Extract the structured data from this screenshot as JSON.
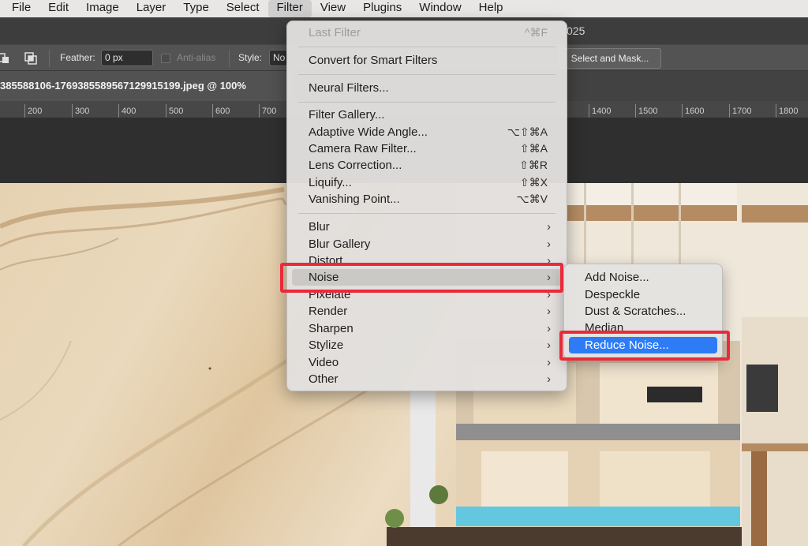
{
  "menubar": {
    "items": [
      "File",
      "Edit",
      "Image",
      "Layer",
      "Type",
      "Select",
      "Filter",
      "View",
      "Plugins",
      "Window",
      "Help"
    ],
    "active": "Filter"
  },
  "window": {
    "title_fragment": "025"
  },
  "options_bar": {
    "feather_label": "Feather:",
    "feather_value": "0 px",
    "antialias_label": "Anti-alias",
    "style_label": "Style:",
    "style_value": "No",
    "select_mask_button": "Select and Mask..."
  },
  "document_tab": {
    "title": "385588106-1769385589567129915199.jpeg @ 100%"
  },
  "ruler": {
    "ticks": [
      "200",
      "300",
      "400",
      "500",
      "600",
      "700",
      "1400",
      "1500",
      "1600",
      "1700",
      "1800"
    ]
  },
  "filter_menu": {
    "last_filter": {
      "label": "Last Filter",
      "shortcut": "^⌘F"
    },
    "convert": "Convert for Smart Filters",
    "neural": "Neural Filters...",
    "items": [
      {
        "label": "Filter Gallery...",
        "shortcut": ""
      },
      {
        "label": "Adaptive Wide Angle...",
        "shortcut": "⌥⇧⌘A"
      },
      {
        "label": "Camera Raw Filter...",
        "shortcut": "⇧⌘A"
      },
      {
        "label": "Lens Correction...",
        "shortcut": "⇧⌘R"
      },
      {
        "label": "Liquify...",
        "shortcut": "⇧⌘X"
      },
      {
        "label": "Vanishing Point...",
        "shortcut": "⌥⌘V"
      }
    ],
    "groups": [
      "Blur",
      "Blur Gallery",
      "Distort",
      "Noise",
      "Pixelate",
      "Render",
      "Sharpen",
      "Stylize",
      "Video",
      "Other"
    ],
    "highlighted": "Noise",
    "submenu_arrow": "›"
  },
  "noise_submenu": {
    "items": [
      "Add Noise...",
      "Despeckle",
      "Dust & Scratches...",
      "Median",
      "Reduce Noise..."
    ],
    "selected": "Reduce Noise..."
  },
  "colors": {
    "highlight_red": "#ea2a3a",
    "selection_blue": "#2d7cf6"
  }
}
